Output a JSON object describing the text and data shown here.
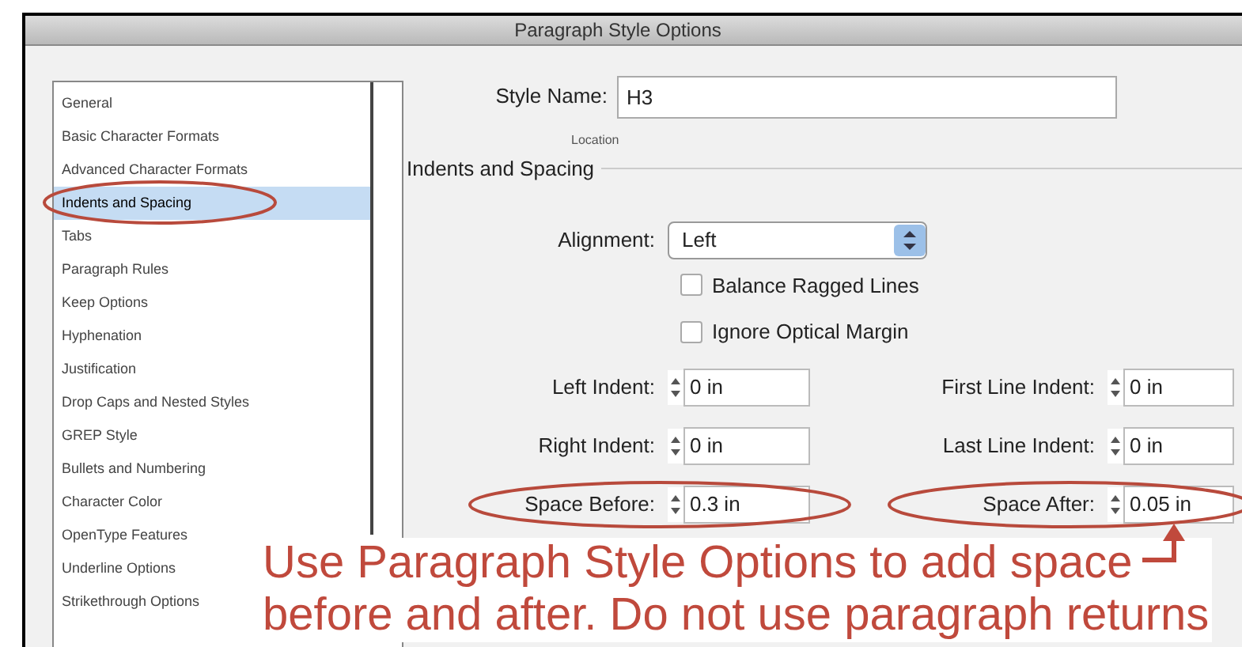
{
  "window": {
    "title": "Paragraph Style Options"
  },
  "sidebar": {
    "items": [
      {
        "label": "General",
        "selected": false
      },
      {
        "label": "Basic Character Formats",
        "selected": false
      },
      {
        "label": "Advanced Character Formats",
        "selected": false
      },
      {
        "label": "Indents and Spacing",
        "selected": true
      },
      {
        "label": "Tabs",
        "selected": false
      },
      {
        "label": "Paragraph Rules",
        "selected": false
      },
      {
        "label": "Keep Options",
        "selected": false
      },
      {
        "label": "Hyphenation",
        "selected": false
      },
      {
        "label": "Justification",
        "selected": false
      },
      {
        "label": "Drop Caps and Nested Styles",
        "selected": false
      },
      {
        "label": "GREP Style",
        "selected": false
      },
      {
        "label": "Bullets and Numbering",
        "selected": false
      },
      {
        "label": "Character Color",
        "selected": false
      },
      {
        "label": "OpenType Features",
        "selected": false
      },
      {
        "label": "Underline Options",
        "selected": false
      },
      {
        "label": "Strikethrough Options",
        "selected": false
      }
    ]
  },
  "style_name": {
    "label": "Style Name:",
    "value": "H3"
  },
  "location_label": "Location",
  "section_title": "Indents and Spacing",
  "alignment": {
    "label": "Alignment:",
    "value": "Left"
  },
  "checkboxes": [
    {
      "label": "Balance Ragged Lines",
      "checked": false
    },
    {
      "label": "Ignore Optical Margin",
      "checked": false
    }
  ],
  "fields": [
    [
      {
        "label": "Left Indent:",
        "value": "0 in",
        "circled": false
      },
      {
        "label": "First Line Indent:",
        "value": "0 in",
        "circled": false
      }
    ],
    [
      {
        "label": "Right Indent:",
        "value": "0 in",
        "circled": false
      },
      {
        "label": "Last Line Indent:",
        "value": "0 in",
        "circled": false
      }
    ],
    [
      {
        "label": "Space Before:",
        "value": "0.3 in",
        "circled": true
      },
      {
        "label": "Space After:",
        "value": "0.05 in",
        "circled": true
      }
    ]
  ],
  "annotation": {
    "lines": [
      "Use Paragraph Style Options to add space",
      "before and after. Do not use paragraph returns"
    ]
  }
}
